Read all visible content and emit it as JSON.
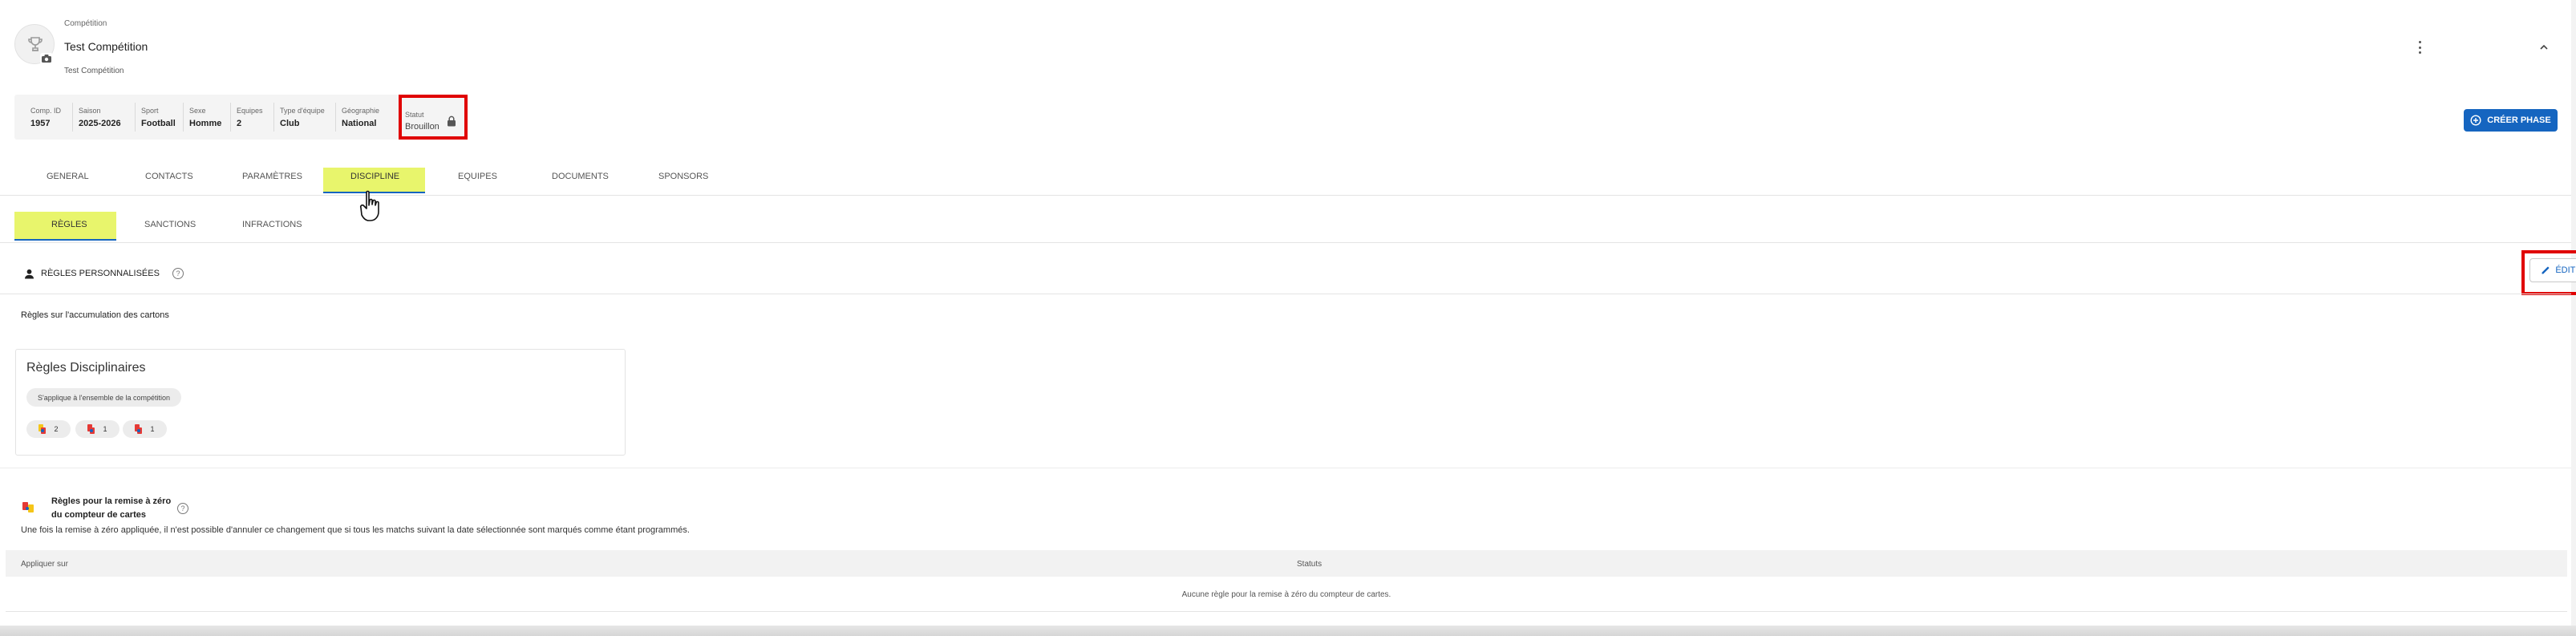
{
  "header": {
    "eyebrow": "Compétition",
    "title": "Test Compétition",
    "subtitle": "Test Compétition"
  },
  "info": {
    "comp_id": {
      "label": "Comp. ID",
      "value": "1957"
    },
    "saison": {
      "label": "Saison",
      "value": "2025-2026"
    },
    "sport": {
      "label": "Sport",
      "value": "Football"
    },
    "sexe": {
      "label": "Sexe",
      "value": "Homme"
    },
    "equipes": {
      "label": "Equipes",
      "value": "2"
    },
    "type_equipe": {
      "label": "Type d'équipe",
      "value": "Club"
    },
    "geographie": {
      "label": "Géographie",
      "value": "National"
    },
    "statut": {
      "label": "Statut",
      "value": "Brouillon"
    }
  },
  "actions": {
    "create_phase": "CRÉER PHASE",
    "edit": "ÉDITER"
  },
  "tabs": [
    "GENERAL",
    "CONTACTS",
    "PARAMÈTRES",
    "DISCIPLINE",
    "EQUIPES",
    "DOCUMENTS",
    "SPONSORS"
  ],
  "active_tab": "DISCIPLINE",
  "subtabs": [
    "RÈGLES",
    "SANCTIONS",
    "INFRACTIONS"
  ],
  "active_subtab": "RÈGLES",
  "regles": {
    "header": "RÈGLES PERSONNALISÉES",
    "cards_title": "Règles sur l'accumulation des cartons",
    "card": {
      "title": "Règles Disciplinaires",
      "scope": "S'applique à l'ensemble de la compétition",
      "chips": [
        {
          "icon": "yellow-red-card-icon",
          "count": "2"
        },
        {
          "icon": "red-card-icon",
          "count": "1"
        },
        {
          "icon": "red-card-icon",
          "count": "1"
        }
      ]
    }
  },
  "reset": {
    "title": "Règles pour la remise à zéro du compteur de cartes",
    "description": "Une fois la remise à zéro appliquée, il n'est possible d'annuler ce changement que si tous les matchs suivant la date sélectionnée sont marqués comme étant programmés.",
    "columns": {
      "apply_on": "Appliquer sur",
      "status": "Statuts"
    },
    "empty": "Aucune règle pour la remise à zéro du compteur de cartes."
  },
  "colors": {
    "primary": "#1565c0",
    "highlight": "#e8f56c",
    "annotation_red": "#e00000",
    "card_yellow": "#f5c518",
    "card_red": "#e53935"
  }
}
